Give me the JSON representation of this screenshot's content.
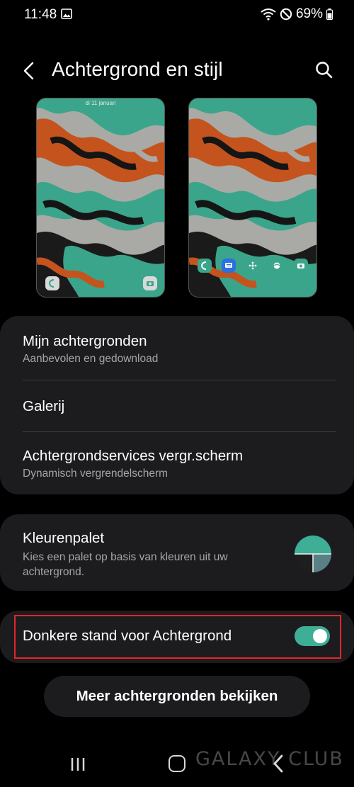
{
  "status_bar": {
    "time": "11:48",
    "battery": "69%",
    "icons": [
      "image-icon",
      "wifi-icon",
      "do-not-disturb-icon",
      "battery-icon"
    ]
  },
  "header": {
    "title": "Achtergrond en stijl",
    "back_icon": "chevron-left-icon",
    "search_icon": "search-icon"
  },
  "previews": {
    "lock_date": "di 11 januari"
  },
  "wallpaper_menu": {
    "items": [
      {
        "title": "Mijn achtergronden",
        "subtitle": "Aanbevolen en gedownload"
      },
      {
        "title": "Galerij",
        "subtitle": ""
      },
      {
        "title": "Achtergrondservices vergr.scherm",
        "subtitle": "Dynamisch vergrendelscherm"
      }
    ]
  },
  "palette": {
    "title": "Kleurenpalet",
    "subtitle": "Kies een palet op basis van kleuren uit uw achtergrond.",
    "colors": [
      "#3fae97",
      "#1e1e1e",
      "#5a7f86",
      "#f2f2f2"
    ]
  },
  "dark_mode": {
    "label": "Donkere stand voor Achtergrond",
    "enabled": true
  },
  "more_button": "Meer achtergronden bekijken",
  "watermark": "GALAXY CLUB",
  "colors": {
    "background": "#000000",
    "card": "#1c1c1e",
    "accent": "#3fae97",
    "highlight": "#e3262b",
    "wallpaper_orange": "#c4531e",
    "wallpaper_teal": "#3aa58b",
    "wallpaper_grey": "#a9aaa5"
  }
}
